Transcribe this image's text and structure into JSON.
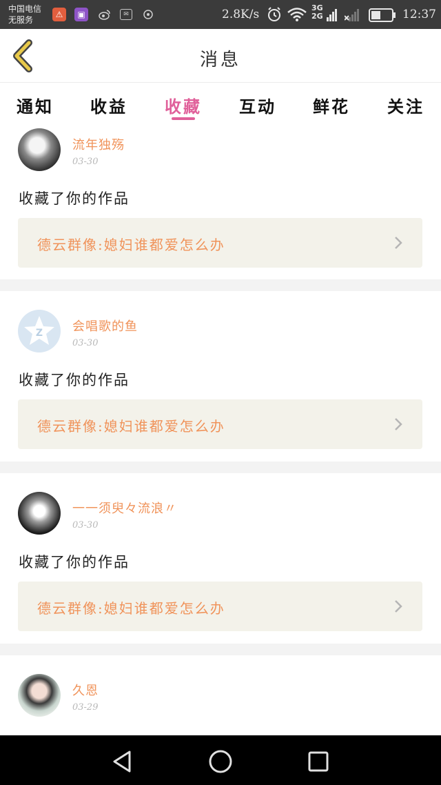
{
  "status_bar": {
    "carrier_line1": "中国电信",
    "carrier_line2": "无服务",
    "speed": "2.8K/s",
    "net_top": "3G",
    "net_bottom": "2G",
    "time": "12:37",
    "icons": [
      "warning-icon",
      "image-icon",
      "weibo-icon",
      "mail-icon",
      "sync-icon",
      "alarm-icon",
      "wifi-icon",
      "signal-icon",
      "battery-icon"
    ]
  },
  "header": {
    "title": "消息",
    "back_icon": "chevron-left-icon",
    "accent_color": "#e8c94a"
  },
  "tabs": [
    {
      "label": "通知",
      "active": false
    },
    {
      "label": "收益",
      "active": false
    },
    {
      "label": "收藏",
      "active": true
    },
    {
      "label": "互动",
      "active": false
    },
    {
      "label": "鲜花",
      "active": false
    },
    {
      "label": "关注",
      "active": false
    }
  ],
  "active_color": "#e0609a",
  "name_color": "#f0935a",
  "messages": [
    {
      "user": "流年独殇",
      "date": "03-30",
      "action": "收藏了你的作品",
      "work": "德云群像:媳妇谁都爱怎么办",
      "avatar": "avatar-photo-1"
    },
    {
      "user": "会唱歌的鱼",
      "date": "03-30",
      "action": "收藏了你的作品",
      "work": "德云群像:媳妇谁都爱怎么办",
      "avatar": "avatar-default-star"
    },
    {
      "user": "一一须臾々流浪〃",
      "date": "03-30",
      "action": "收藏了你的作品",
      "work": "德云群像:媳妇谁都爱怎么办",
      "avatar": "avatar-photo-3"
    },
    {
      "user": "久恩",
      "date": "03-29",
      "action": "",
      "work": "",
      "avatar": "avatar-photo-4"
    }
  ],
  "nav": [
    "back-triangle-icon",
    "home-circle-icon",
    "recents-square-icon"
  ]
}
